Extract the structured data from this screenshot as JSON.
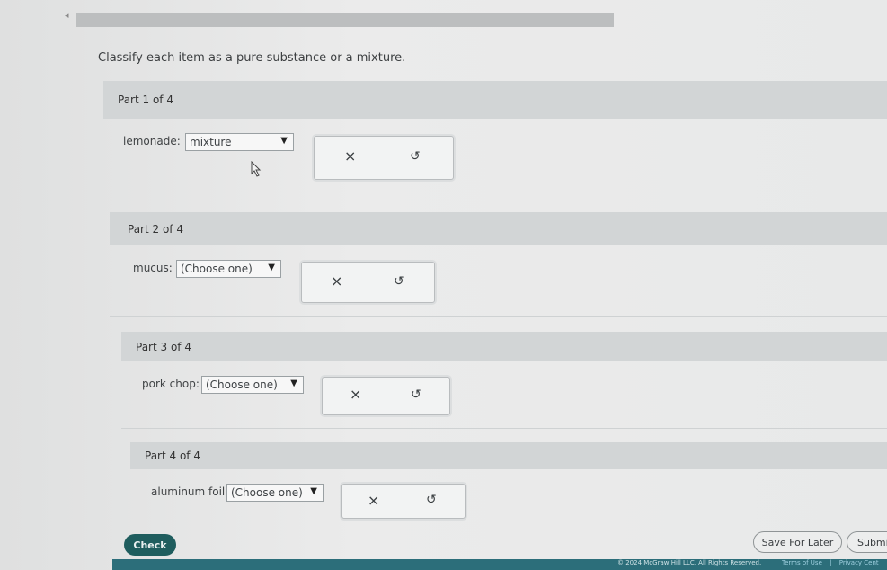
{
  "question": "Classify each item as a pure substance or a mixture.",
  "parts": [
    {
      "header": "Part 1 of 4",
      "label": "lemonade:",
      "selected": "mixture"
    },
    {
      "header": "Part 2 of 4",
      "label": "mucus:",
      "selected": "(Choose one)"
    },
    {
      "header": "Part 3 of 4",
      "label": "pork chop:",
      "selected": "(Choose one)"
    },
    {
      "header": "Part 4 of 4",
      "label": "aluminum foil:",
      "selected": "(Choose one)"
    }
  ],
  "glyphs": {
    "clear": "×",
    "undo": "↺",
    "dropdown": "▼"
  },
  "buttons": {
    "check": "Check",
    "save": "Save For Later",
    "submit": "Submi"
  },
  "footer": {
    "copyright": "© 2024 McGraw Hill LLC. All Rights Reserved.",
    "terms": "Terms of Use",
    "divider": "|",
    "privacy": "Privacy Cent"
  },
  "colors": {
    "check_button": "#1f5d5e",
    "footer_bar": "#2c6e7a"
  }
}
